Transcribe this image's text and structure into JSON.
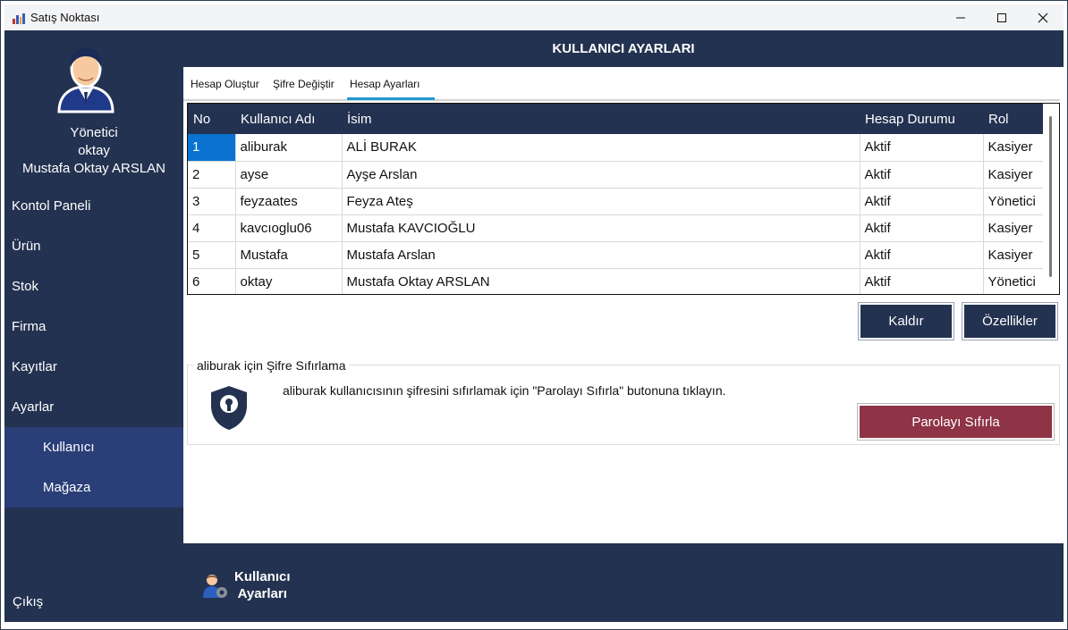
{
  "window": {
    "title": "Satış Noktası"
  },
  "sidebar": {
    "user": {
      "role": "Yönetici",
      "username": "oktay",
      "full_name": "Mustafa Oktay ARSLAN"
    },
    "items": [
      {
        "label": "Kontol Paneli"
      },
      {
        "label": "Ürün"
      },
      {
        "label": "Stok"
      },
      {
        "label": "Firma"
      },
      {
        "label": "Kayıtlar"
      },
      {
        "label": "Ayarlar"
      }
    ],
    "sub_items": [
      {
        "label": "Kullanıcı"
      },
      {
        "label": "Mağaza"
      }
    ],
    "exit_label": "Çıkış"
  },
  "header": {
    "title": "KULLANICI AYARLARI"
  },
  "tabs": [
    {
      "label": "Hesap Oluştur"
    },
    {
      "label": "Şifre Değiştir"
    },
    {
      "label": "Hesap Ayarları",
      "active": true
    }
  ],
  "users_table": {
    "columns": [
      "No",
      "Kullanıcı Adı",
      "İsim",
      "Hesap Durumu",
      "Rol"
    ],
    "rows": [
      {
        "no": "1",
        "username": "aliburak",
        "name": "ALİ BURAK",
        "status": "Aktif",
        "role": "Kasiyer"
      },
      {
        "no": "2",
        "username": "ayse",
        "name": "Ayşe Arslan",
        "status": "Aktif",
        "role": "Kasiyer"
      },
      {
        "no": "3",
        "username": "feyzaates",
        "name": "Feyza Ateş",
        "status": "Aktif",
        "role": "Yönetici"
      },
      {
        "no": "4",
        "username": "kavcıoglu06",
        "name": "Mustafa KAVCIOĞLU",
        "status": "Aktif",
        "role": "Kasiyer"
      },
      {
        "no": "5",
        "username": "Mustafa",
        "name": "Mustafa Arslan",
        "status": "Aktif",
        "role": "Kasiyer"
      },
      {
        "no": "6",
        "username": "oktay",
        "name": "Mustafa Oktay ARSLAN",
        "status": "Aktif",
        "role": "Yönetici"
      }
    ]
  },
  "actions": {
    "remove_label": "Kaldır",
    "properties_label": "Özellikler"
  },
  "password_reset": {
    "legend": "aliburak için Şifre Sıfırlama",
    "message": "aliburak kullanıcısının şifresini sıfırlamak için \"Parolayı Sıfırla\" butonuna tıklayın.",
    "button_label": "Parolayı Sıfırla"
  },
  "footer": {
    "line1": "Kullanıcı",
    "line2": "Ayarları"
  },
  "colors": {
    "navy": "#233250",
    "submenu": "#2a3e78",
    "selection": "#0a72d0",
    "reset_button": "#8e3446",
    "tab_underline": "#1e9ad6"
  }
}
